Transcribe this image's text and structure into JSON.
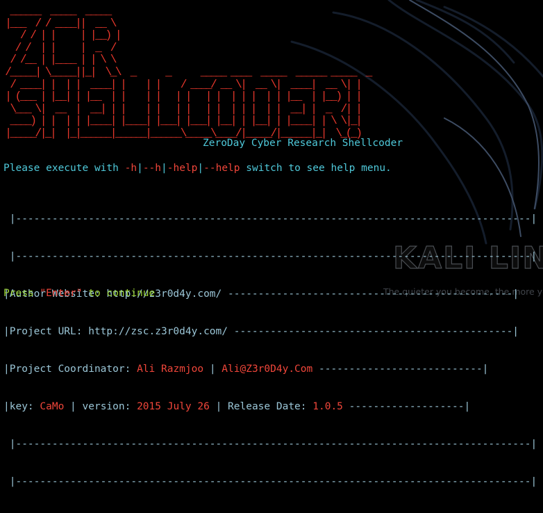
{
  "wallpaper": {
    "logo_text": "KALI LINUX",
    "tagline": "The quieter you become, the more you are able to hear"
  },
  "banner": {
    "ascii_art": "  ______  _____  _____\n |___  / / ____||  __ \\\n    / / | |     | |__) |\n   / /  | |     |  _  /\n  / /__ | |____ | | \\ \\\n /_____| \\_____||_|  \\_\\  _      _      _____ ____  _____  ______ _____  _\n  / ____| |  | |  ____| |    | |    / ____/ __ \\|  __ \\|  ____|  __ \\| |\n | (___ | |__| | |__  | |    | |   | |   | |  | | |  | | |__  | |__) | |\n  \\___ \\|  __  |  __| | |    | |   | |   | |  | | |  | |  __| |  _  /| |\n  ____) | |  | | |____| |____| |___| |___| |__| | |__| | |____| | \\ \\|_|\n |_____/|_|  |_|______|______|______\\_____\\____/|_____/|______|_|  \\_(_)",
    "subtitle": "ZeroDay Cyber Research Shellcoder"
  },
  "help_line": {
    "prefix": "Please execute with ",
    "flag1": "-h",
    "sep1": "|",
    "flag2": "--h",
    "sep2": "|",
    "flag3": "-help",
    "sep3": "|",
    "flag4": "--help",
    "suffix": " switch to see help menu."
  },
  "info_box": {
    "border_line": " |-------------------------------------------------------------------------------------|",
    "author_label": "|Author Website: http://z3r0d4y.com/ ",
    "author_dashes": "-----------------------------------------------|",
    "project_label": "|Project URL: http://zsc.z3r0d4y.com/ ",
    "project_dashes": "----------------------------------------------|",
    "coord_label": "|Project Coordinator: ",
    "coord_name": "Ali Razmjoo",
    "coord_sep": " | ",
    "coord_email": "Ali@Z3r0D4y.Com",
    "coord_dashes": " ---------------------------|",
    "key_label": "|key: ",
    "key_value": "CaMo",
    "version_label": " | version: ",
    "version_value": "2015 July 26",
    "release_label": " | Release Date: ",
    "release_value": "1.0.5",
    "key_dashes": " -------------------|"
  },
  "prompt": {
    "press": "Press ",
    "enter": "\"Enter\"",
    "continue": " to continue"
  }
}
